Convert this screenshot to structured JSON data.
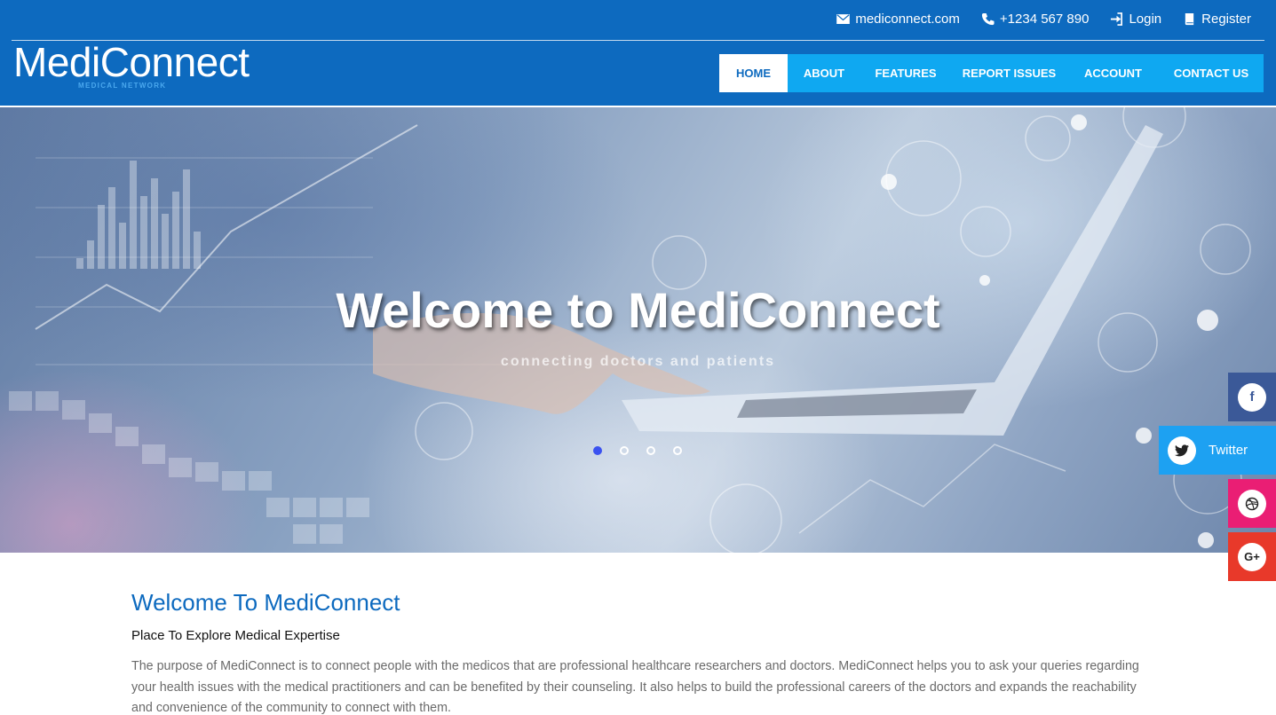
{
  "topbar": {
    "email": "mediconnect.com",
    "phone": "+1234 567 890",
    "login": "Login",
    "register": "Register"
  },
  "brand": {
    "name": "MediConnect",
    "tagline": "MEDICAL NETWORK"
  },
  "nav": {
    "items": [
      {
        "label": "HOME",
        "active": true
      },
      {
        "label": "ABOUT"
      },
      {
        "label": "FEATURES"
      },
      {
        "label": "REPORT ISSUES"
      },
      {
        "label": "ACCOUNT"
      },
      {
        "label": "CONTACT US"
      }
    ]
  },
  "hero": {
    "title": "Welcome to MediConnect",
    "subtitle": "connecting doctors and patients",
    "slides": 4,
    "active_slide": 1
  },
  "social": {
    "facebook": {
      "glyph": "f",
      "color": "#3b5998"
    },
    "twitter": {
      "label": "Twitter",
      "color": "#1da1f2"
    },
    "dribbble": {
      "color": "#ea1e74"
    },
    "googleplus": {
      "glyph": "G+",
      "color": "#e8392a"
    }
  },
  "main": {
    "title": "Welcome To MediConnect",
    "subtitle": "Place To Explore Medical Expertise",
    "body": "The purpose of MediConnect is to connect people with the medicos that are professional healthcare researchers and doctors. MediConnect helps you to ask your queries regarding your health issues with the medical practitioners and can be benefited by their counseling. It also helps to build the professional careers of the doctors and expands the reachability and convenience of the community to connect with them."
  },
  "colors": {
    "header_blue": "#0d6abf",
    "nav_cyan": "#0fa8f1",
    "active_dot": "#3b52f0"
  }
}
